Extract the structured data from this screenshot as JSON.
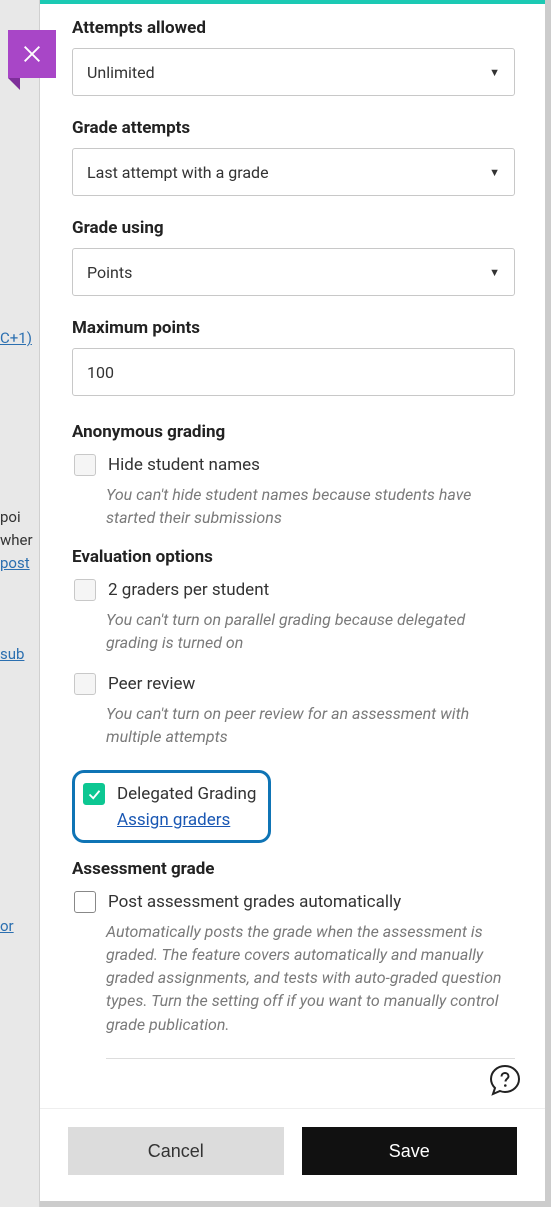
{
  "bg": {
    "t1": "C+1)",
    "t2": " poi",
    "t3": "wher",
    "t4": "post",
    "t5": "sub",
    "t6": "or"
  },
  "fields": {
    "attempts_label": "Attempts allowed",
    "attempts_value": "Unlimited",
    "grade_attempts_label": "Grade attempts",
    "grade_attempts_value": "Last attempt with a grade",
    "grade_using_label": "Grade using",
    "grade_using_value": "Points",
    "max_points_label": "Maximum points",
    "max_points_value": "100"
  },
  "anonymous": {
    "title": "Anonymous grading",
    "hide_label": "Hide student names",
    "hide_hint": "You can't hide student names because students have started their submissions"
  },
  "evaluation": {
    "title": "Evaluation options",
    "two_graders_label": "2 graders per student",
    "two_graders_hint": "You can't turn on parallel grading because delegated grading is turned on",
    "peer_label": "Peer review",
    "peer_hint": "You can't turn on peer review for an assessment with multiple attempts",
    "delegated_label": "Delegated Grading",
    "assign_link": "Assign graders"
  },
  "assessment": {
    "title": "Assessment grade",
    "post_label": "Post assessment grades automatically",
    "post_hint": "Automatically posts the grade when the assessment is graded. The feature covers automatically and manually graded assignments, and tests with auto-graded question types. Turn the setting off if you want to manually control grade publication."
  },
  "footer": {
    "cancel": "Cancel",
    "save": "Save"
  }
}
